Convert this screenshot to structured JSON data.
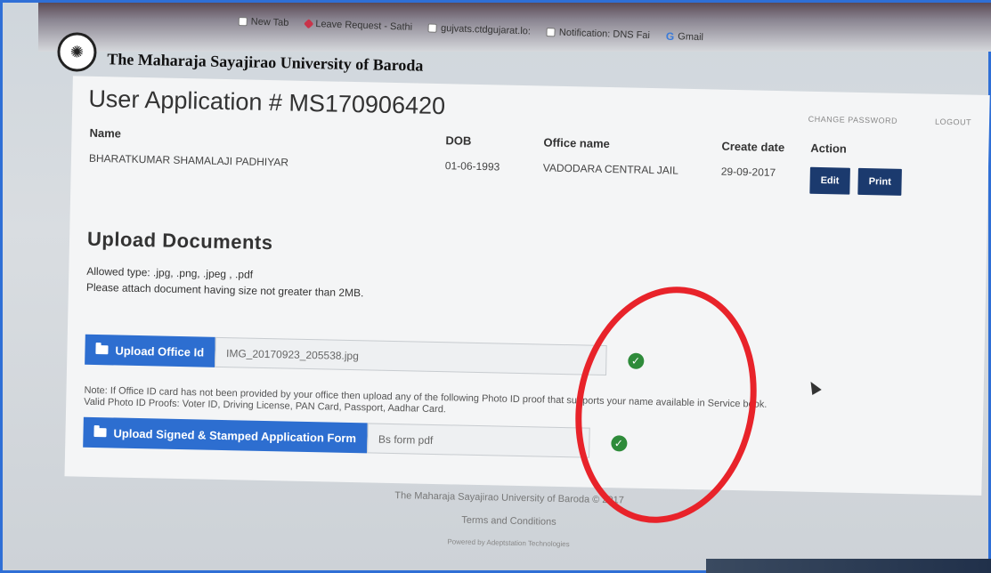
{
  "browser": {
    "bookmarks": [
      {
        "label": "New Tab",
        "icon": "page-icon"
      },
      {
        "label": "Leave Request - Sathi",
        "icon": "diamond-icon"
      },
      {
        "label": "gujvats.ctdgujarat.lo:",
        "icon": "page-icon"
      },
      {
        "label": "Notification: DNS Fai",
        "icon": "page-icon"
      },
      {
        "label": "Gmail",
        "icon": "google-icon"
      }
    ]
  },
  "header": {
    "university_name": "The Maharaja Sayajirao University of Baroda"
  },
  "top_links": {
    "change_password": "CHANGE PASSWORD",
    "logout": "LOGOUT"
  },
  "application": {
    "title": "User Application # MS170906420",
    "columns": {
      "name": "Name",
      "dob": "DOB",
      "office": "Office name",
      "create_date": "Create date",
      "action": "Action"
    },
    "row": {
      "name": "BHARATKUMAR SHAMALAJI PADHIYAR",
      "dob": "01-06-1993",
      "office": "VADODARA CENTRAL JAIL",
      "create_date": "29-09-2017"
    },
    "edit_label": "Edit",
    "print_label": "Print"
  },
  "upload": {
    "title": "Upload Documents",
    "allowed": "Allowed type: .jpg, .png, .jpeg , .pdf",
    "size_note": "Please attach document having size not greater than 2MB.",
    "office_id_label": "Upload Office Id",
    "office_id_file": "IMG_20170923_205538.jpg",
    "note_line1": "Note: If Office ID card has not been provided by your office then upload any of the following Photo ID proof that supports your name available in Service book.",
    "note_line2": "Valid Photo ID Proofs: Voter ID, Driving License, PAN Card, Passport, Aadhar Card.",
    "form_label": "Upload Signed & Stamped Application Form",
    "form_file": "Bs form pdf"
  },
  "footer": {
    "copyright": "The Maharaja Sayajirao University of Baroda © 2017",
    "terms": "Terms and Conditions",
    "powered": "Powered by Adeptstation Technologies"
  },
  "colors": {
    "primary_button": "#2d6ed0",
    "dark_button": "#1b3a6e",
    "success": "#2e8b3a",
    "annotation": "#e8232a"
  }
}
